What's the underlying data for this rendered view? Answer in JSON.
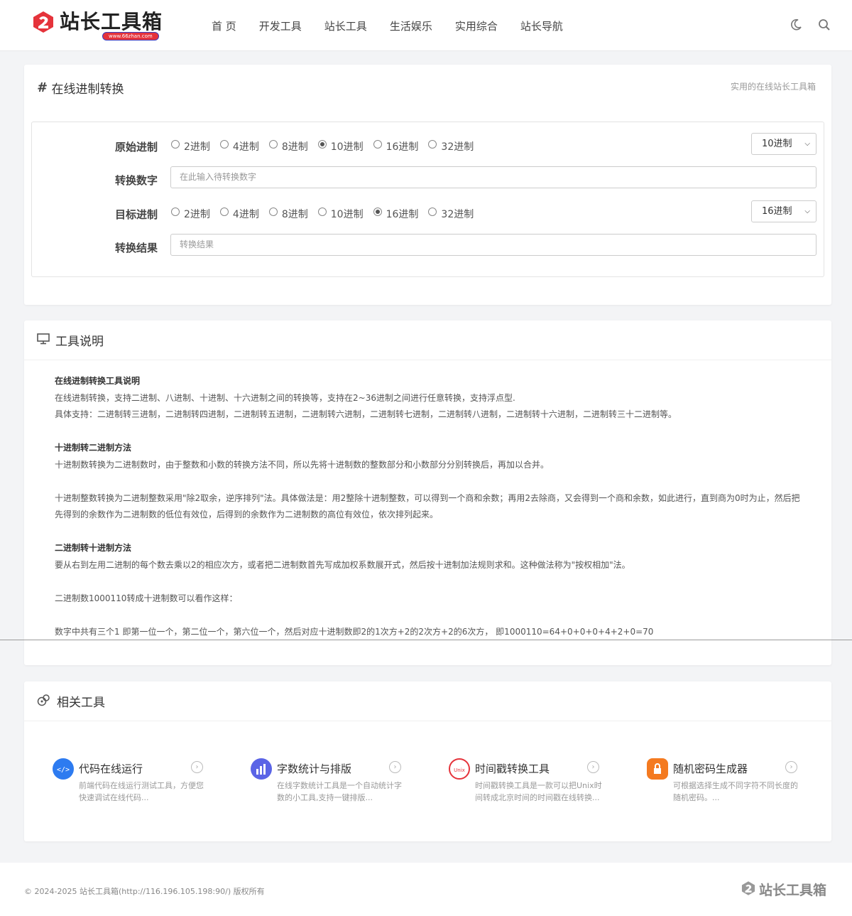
{
  "header": {
    "logo_title": "站长工具箱",
    "logo_url": "www.66zhan.com",
    "nav": [
      "首 页",
      "开发工具",
      "站长工具",
      "生活娱乐",
      "实用综合",
      "站长导航"
    ],
    "icons": [
      "moon-icon",
      "search-icon"
    ]
  },
  "converter": {
    "title": "在线进制转换",
    "subtitle": "实用的在线站长工具箱",
    "source_label": "原始进制",
    "number_label": "转换数字",
    "target_label": "目标进制",
    "result_label": "转换结果",
    "bases": [
      "2进制",
      "4进制",
      "8进制",
      "10进制",
      "16进制",
      "32进制"
    ],
    "source_selected": "10进制",
    "target_selected": "16进制",
    "number_placeholder": "在此输入待转换数字",
    "result_placeholder": "转换结果"
  },
  "description": {
    "title": "工具说明",
    "h1": "在线进制转换工具说明",
    "p1": "在线进制转换，支持二进制、八进制、十进制、十六进制之间的转换等，支持在2~36进制之间进行任意转换，支持浮点型.",
    "p2": "具体支持：二进制转三进制，二进制转四进制，二进制转五进制，二进制转六进制，二进制转七进制，二进制转八进制，二进制转十六进制，二进制转三十二进制等。",
    "h2": "十进制转二进制方法",
    "p3": "十进制数转换为二进制数时，由于整数和小数的转换方法不同，所以先将十进制数的整数部分和小数部分分别转换后，再加以合并。",
    "p4": "十进制整数转换为二进制整数采用\"除2取余，逆序排列\"法。具体做法是：用2整除十进制整数，可以得到一个商和余数；再用2去除商，又会得到一个商和余数，如此进行，直到商为0时为止，然后把先得到的余数作为二进制数的低位有效位，后得到的余数作为二进制数的高位有效位，依次排列起来。",
    "h3": "二进制转十进制方法",
    "p5": "要从右到左用二进制的每个数去乘以2的相应次方，或者把二进制数首先写成加权系数展开式，然后按十进制加法规则求和。这种做法称为\"按权相加\"法。",
    "p6": "二进制数1000110转成十进制数可以看作这样：",
    "p7": "数字中共有三个1 即第一位一个，第二位一个，第六位一个，然后对应十进制数即2的1次方+2的2次方+2的6次方， 即1000110=64+0+0+0+4+2+0=70"
  },
  "related": {
    "title": "相关工具",
    "tools": [
      {
        "name": "代码在线运行",
        "desc": "前端代码在线运行测试工具，方便您快速调试在线代码...",
        "color": "#2d7bf0"
      },
      {
        "name": "字数统计与排版",
        "desc": "在线字数统计工具是一个自动统计字数的小工具,支持一键排版...",
        "color": "#5a64e6"
      },
      {
        "name": "时间戳转换工具",
        "desc": "时间戳转换工具是一款可以把Unix时间转成北京时间的时间戳在线转换...",
        "color": "#e5333b"
      },
      {
        "name": "随机密码生成器",
        "desc": "可根据选择生成不同字符不同长度的随机密码。...",
        "color": "#f47a20"
      }
    ]
  },
  "footer": {
    "copyright": "© 2024-2025 站长工具箱(http://116.196.105.198:90/) 版权所有",
    "logo_title": "站长工具箱"
  }
}
